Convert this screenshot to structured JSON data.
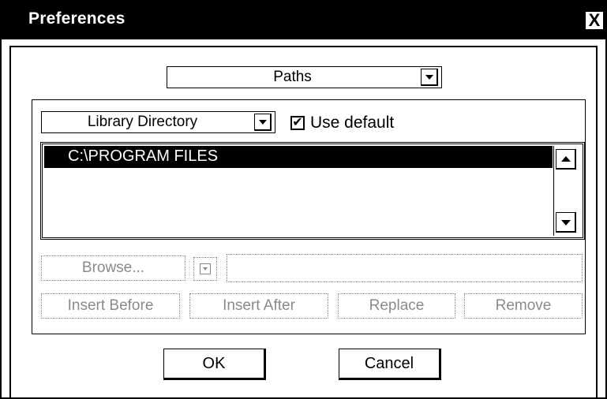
{
  "window": {
    "title": "Preferences",
    "close_label": "X"
  },
  "category_select": {
    "value": "Paths"
  },
  "directory_select": {
    "value": "Library Directory"
  },
  "use_default": {
    "label": "Use default",
    "checked": true,
    "check_glyph": "✔"
  },
  "path_list": {
    "items": [
      "C:\\PROGRAM FILES"
    ],
    "selected_index": 0
  },
  "path_edit": {
    "browse_label": "Browse...",
    "value": "",
    "insert_before_label": "Insert Before",
    "insert_after_label": "Insert After",
    "replace_label": "Replace",
    "remove_label": "Remove"
  },
  "footer": {
    "ok_label": "OK",
    "cancel_label": "Cancel"
  },
  "icons": {
    "close": "close-icon",
    "dropdown": "chevron-down-icon",
    "scroll_up": "arrow-up-icon",
    "scroll_down": "arrow-down-icon",
    "checkmark": "checkmark-icon"
  },
  "colors": {
    "titlebar_bg": "#000000",
    "titlebar_text": "#ffffff",
    "disabled_text": "#8a8a8a",
    "selection_bg": "#000000"
  }
}
